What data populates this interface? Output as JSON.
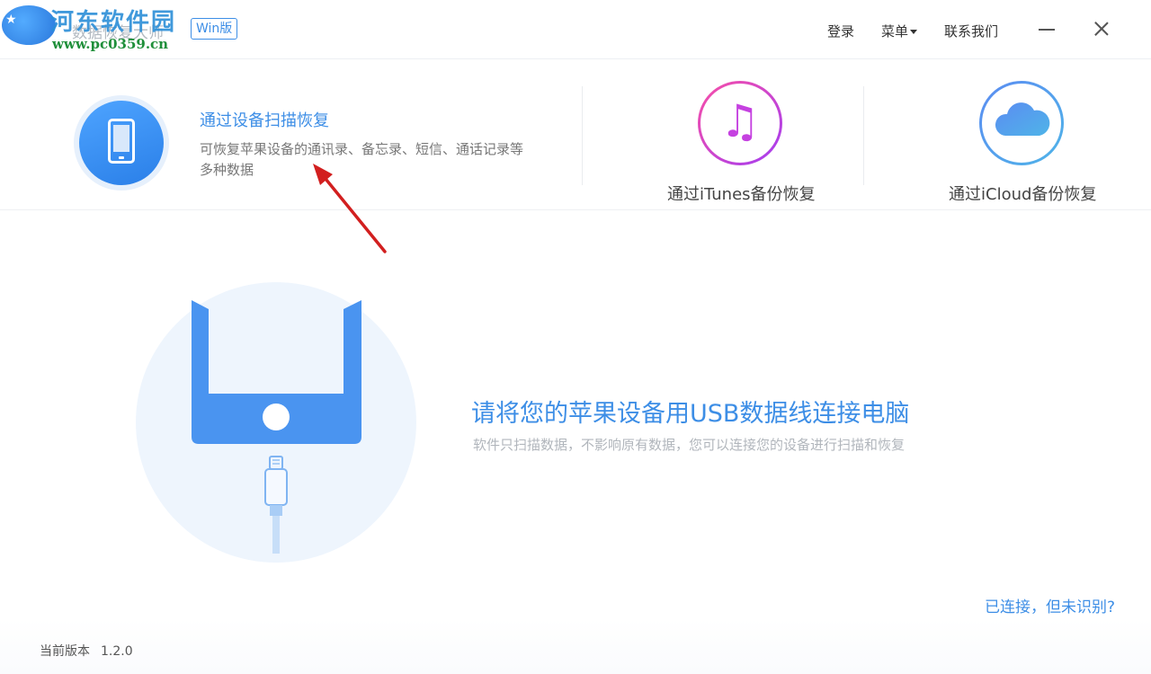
{
  "watermark": {
    "name": "河东软件园",
    "url": "www.pc0359.cn"
  },
  "app": {
    "name": "数据恢复大师",
    "badge": "Win版"
  },
  "top_nav": {
    "login": "登录",
    "menu": "菜单",
    "contact": "联系我们"
  },
  "modes": {
    "device": {
      "title": "通过设备扫描恢复",
      "desc_line1": "可恢复苹果设备的通讯录、备忘录、短信、通话记录等",
      "desc_line2": "多种数据"
    },
    "itunes": {
      "label": "通过iTunes备份恢复"
    },
    "icloud": {
      "label": "通过iCloud备份恢复"
    }
  },
  "main": {
    "title": "请将您的苹果设备用USB数据线连接电脑",
    "subtitle": "软件只扫描数据，不影响原有数据，您可以连接您的设备进行扫描和恢复",
    "help_link": "已连接，但未识别?"
  },
  "footer": {
    "version_label": "当前版本",
    "version_value": "1.2.0"
  },
  "colors": {
    "accent": "#3d8ee6",
    "itunes_gradient": [
      "#f94fa6",
      "#a33df2"
    ],
    "icloud_gradient": [
      "#5b8cf2",
      "#4fb4e8"
    ],
    "annotation": "#d21f1f"
  }
}
